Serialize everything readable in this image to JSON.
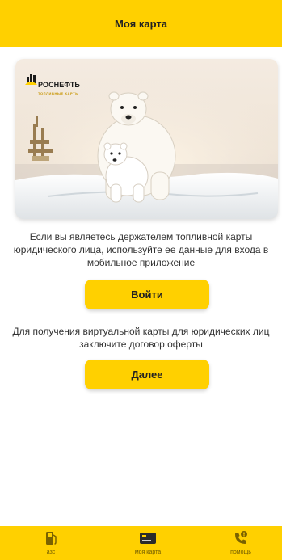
{
  "header": {
    "title": "Моя карта"
  },
  "card": {
    "brand_name": "РОСНЕФТЬ",
    "brand_subtitle": "ТОПЛИВНЫЕ КАРТЫ"
  },
  "info": {
    "holder_text": "Если вы являетесь держателем топливной карты юридического лица, используйте ее данные для входа в мобильное приложение",
    "virtual_text": "Для получения виртуальной карты для юридических лиц заключите договор оферты"
  },
  "buttons": {
    "login": "Войти",
    "next": "Далее"
  },
  "tabs": [
    {
      "label": "азс",
      "icon": "fuel-pump-icon"
    },
    {
      "label": "моя карта",
      "icon": "card-icon"
    },
    {
      "label": "помощь",
      "icon": "phone-help-icon"
    }
  ],
  "colors": {
    "accent": "#FFD000",
    "text": "#333333"
  }
}
